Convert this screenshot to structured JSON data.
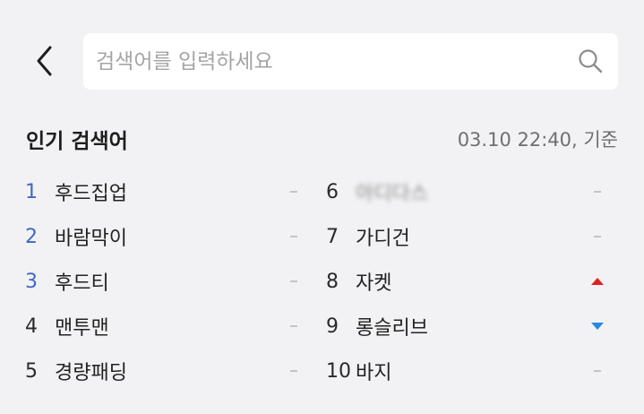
{
  "search": {
    "placeholder": "검색어를 입력하세요",
    "value": ""
  },
  "popular": {
    "title": "인기 검색어",
    "timestamp": "03.10 22:40, 기준"
  },
  "rankings": {
    "left": [
      {
        "rank": "1",
        "term": "후드집업",
        "trend": "none"
      },
      {
        "rank": "2",
        "term": "바람막이",
        "trend": "none"
      },
      {
        "rank": "3",
        "term": "후드티",
        "trend": "none"
      },
      {
        "rank": "4",
        "term": "맨투맨",
        "trend": "none"
      },
      {
        "rank": "5",
        "term": "경량패딩",
        "trend": "none"
      }
    ],
    "right": [
      {
        "rank": "6",
        "term": "아디다스",
        "trend": "none"
      },
      {
        "rank": "7",
        "term": "가디건",
        "trend": "none"
      },
      {
        "rank": "8",
        "term": "자켓",
        "trend": "up"
      },
      {
        "rank": "9",
        "term": "롱슬리브",
        "trend": "down"
      },
      {
        "rank": "10",
        "term": "바지",
        "trend": "none"
      }
    ]
  },
  "colors": {
    "background": "#f2f2f4",
    "top_rank": "#3d68c8",
    "trend_up": "#e02020",
    "trend_down": "#2a86e0",
    "trend_none": "#c4c4c8"
  },
  "icons": {
    "back": "chevron-left-icon",
    "search": "magnifier-icon"
  }
}
